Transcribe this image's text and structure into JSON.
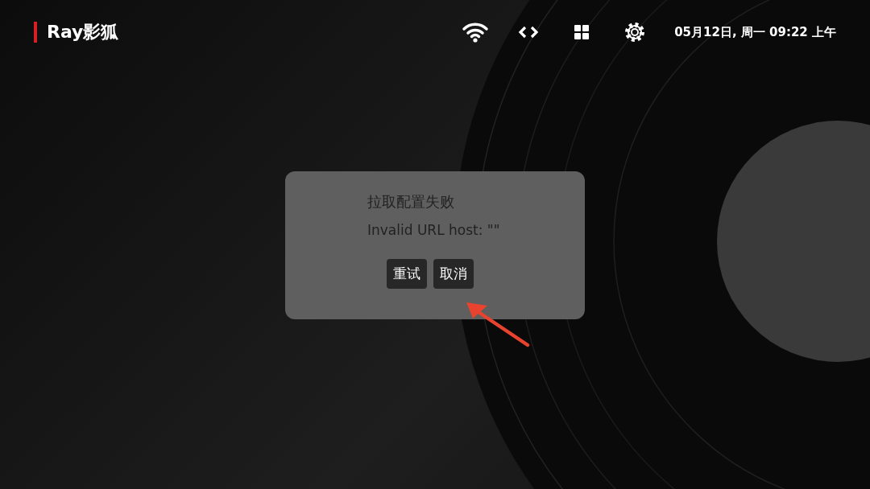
{
  "app": {
    "title": "Ray影狐"
  },
  "status": {
    "datetime": "05月12日, 周一 09:22 上午"
  },
  "dialog": {
    "title": "拉取配置失败",
    "message": "Invalid URL host: \"\"",
    "buttons": [
      {
        "label": "重试"
      },
      {
        "label": "取消"
      }
    ]
  }
}
